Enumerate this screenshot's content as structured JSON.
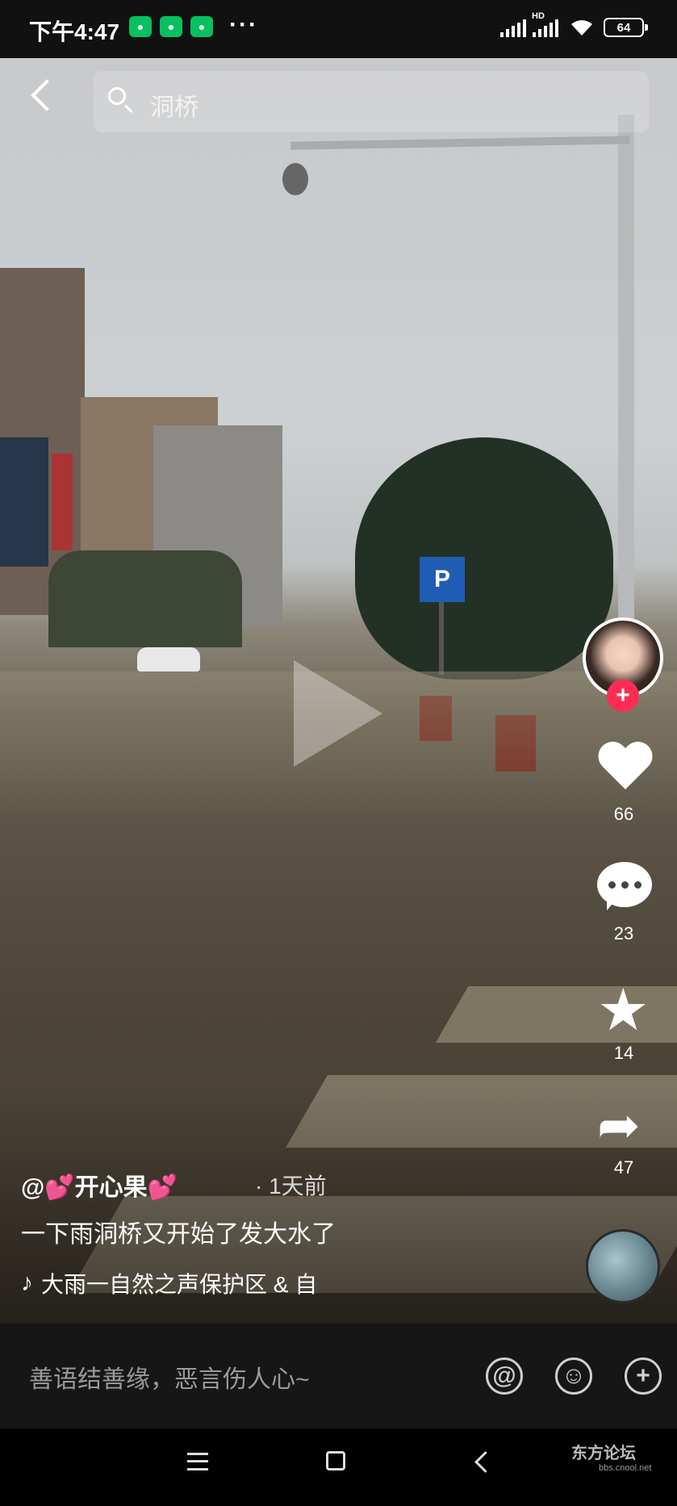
{
  "status_bar": {
    "time": "下午4:47",
    "dots": "···",
    "network": "HD",
    "battery": "64"
  },
  "search": {
    "query": "洞桥"
  },
  "video": {
    "play_icon": "play-icon"
  },
  "side_actions": {
    "likes": "66",
    "comments": "23",
    "favorites": "14",
    "shares": "47",
    "follow_label": "+"
  },
  "post": {
    "author": "@💕开心果💕",
    "time_ago": "· 1天前",
    "caption": "一下雨洞桥又开始了发大水了",
    "music": "大雨一自然之声保护区 & 自"
  },
  "comment_bar": {
    "placeholder": "善语结善缘，恶言伤人心~",
    "at_label": "@",
    "emoji_label": "☺",
    "add_label": "+"
  },
  "watermark": {
    "text": "东方论坛",
    "url_text": "bbs.cnool.net"
  }
}
